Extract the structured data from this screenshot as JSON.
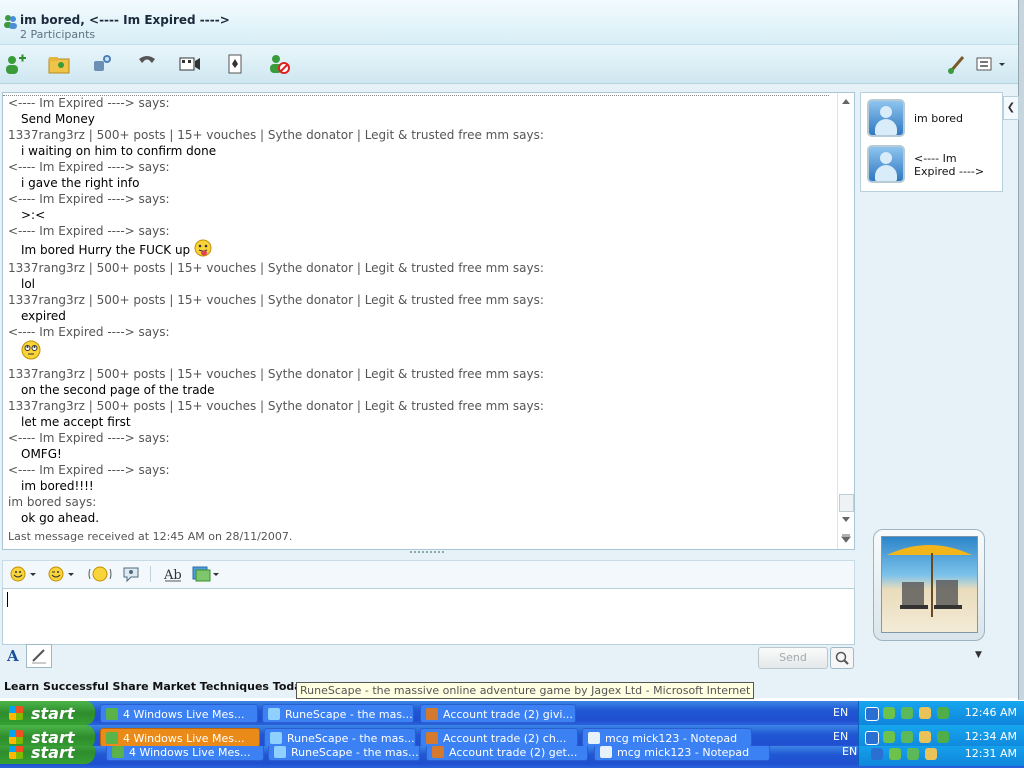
{
  "window": {
    "title": "im bored, <---- Im Expired ---->",
    "participants_count": "2 Participants"
  },
  "toolbar": {
    "icons": [
      "invite-icon",
      "share-files-icon",
      "video-call-icon",
      "call-icon",
      "activities-icon",
      "games-icon",
      "block-icon",
      "paintbrush-icon",
      "display-options-icon"
    ]
  },
  "conversation": {
    "messages": [
      {
        "sender": "<---- Im Expired ----> says:",
        "text": "Send Money"
      },
      {
        "sender": "1337rang3rz | 500+ posts | 15+ vouches | Sythe donator | Legit & trusted free mm says:",
        "text": "i waiting on him to confirm done"
      },
      {
        "sender": "<---- Im Expired ----> says:",
        "text": "i gave the right info"
      },
      {
        "sender": "<---- Im Expired ----> says:",
        "text": ">:<"
      },
      {
        "sender": "<---- Im Expired ----> says:",
        "text": "Im bored Hurry the FUCK up",
        "emoticon": "tongue"
      },
      {
        "sender": "1337rang3rz | 500+ posts | 15+ vouches | Sythe donator | Legit & trusted free mm says:",
        "text": "lol"
      },
      {
        "sender": "1337rang3rz | 500+ posts | 15+ vouches | Sythe donator | Legit & trusted free mm says:",
        "text": "expired"
      },
      {
        "sender": "<---- Im Expired ----> says:",
        "text": "",
        "emoticon": "rolleyes"
      },
      {
        "sender": "1337rang3rz | 500+ posts | 15+ vouches | Sythe donator | Legit & trusted free mm says:",
        "text": "on the second page of the trade"
      },
      {
        "sender": "1337rang3rz | 500+ posts | 15+ vouches | Sythe donator | Legit & trusted free mm says:",
        "text": "let me accept first"
      },
      {
        "sender": "<---- Im Expired ----> says:",
        "text": "OMFG!"
      },
      {
        "sender": "<---- Im Expired ----> says:",
        "text": "im bored!!!!"
      },
      {
        "sender": "im bored says:",
        "text": "ok go ahead."
      }
    ],
    "last_message": "Last message received at 12:45 AM on 28/11/2007."
  },
  "compose": {
    "send_label": "Send"
  },
  "participants": [
    {
      "name": "im bored"
    },
    {
      "name": "<---- Im Expired ---->"
    }
  ],
  "ad_text": "Learn Successful Share Market Techniques Today",
  "tooltip": "RuneScape - the massive online adventure game by Jagex Ltd - Microsoft Internet",
  "taskbars": [
    {
      "start": "start",
      "tasks": [
        {
          "label": "4 Windows Live Mes...",
          "active": false,
          "icon": "messenger-icon"
        },
        {
          "label": "RuneScape - the mas...",
          "active": false,
          "icon": "ie-icon"
        },
        {
          "label": "Account trade (2) givi...",
          "active": false,
          "icon": "firefox-icon"
        }
      ],
      "lang": "EN",
      "clock": "12:46 AM"
    },
    {
      "start": "start",
      "tasks": [
        {
          "label": "4 Windows Live Mes...",
          "active": true,
          "icon": "messenger-icon"
        },
        {
          "label": "RuneScape - the mas...",
          "active": false,
          "icon": "ie-icon"
        },
        {
          "label": "Account trade (2) ch...",
          "active": false,
          "icon": "firefox-icon"
        },
        {
          "label": "mcg mick123 - Notepad",
          "active": false,
          "icon": "notepad-icon"
        }
      ],
      "lang": "EN",
      "clock": "12:34 AM"
    },
    {
      "start": "start",
      "tasks": [
        {
          "label": "4 Windows Live Mes...",
          "active": false,
          "icon": "messenger-icon"
        },
        {
          "label": "RuneScape - the mas...",
          "active": false,
          "icon": "ie-icon"
        },
        {
          "label": "Account trade (2) get...",
          "active": false,
          "icon": "firefox-icon"
        },
        {
          "label": "mcg mick123 - Notepad",
          "active": false,
          "icon": "notepad-icon"
        }
      ],
      "lang": "EN",
      "clock": "12:31 AM"
    }
  ]
}
